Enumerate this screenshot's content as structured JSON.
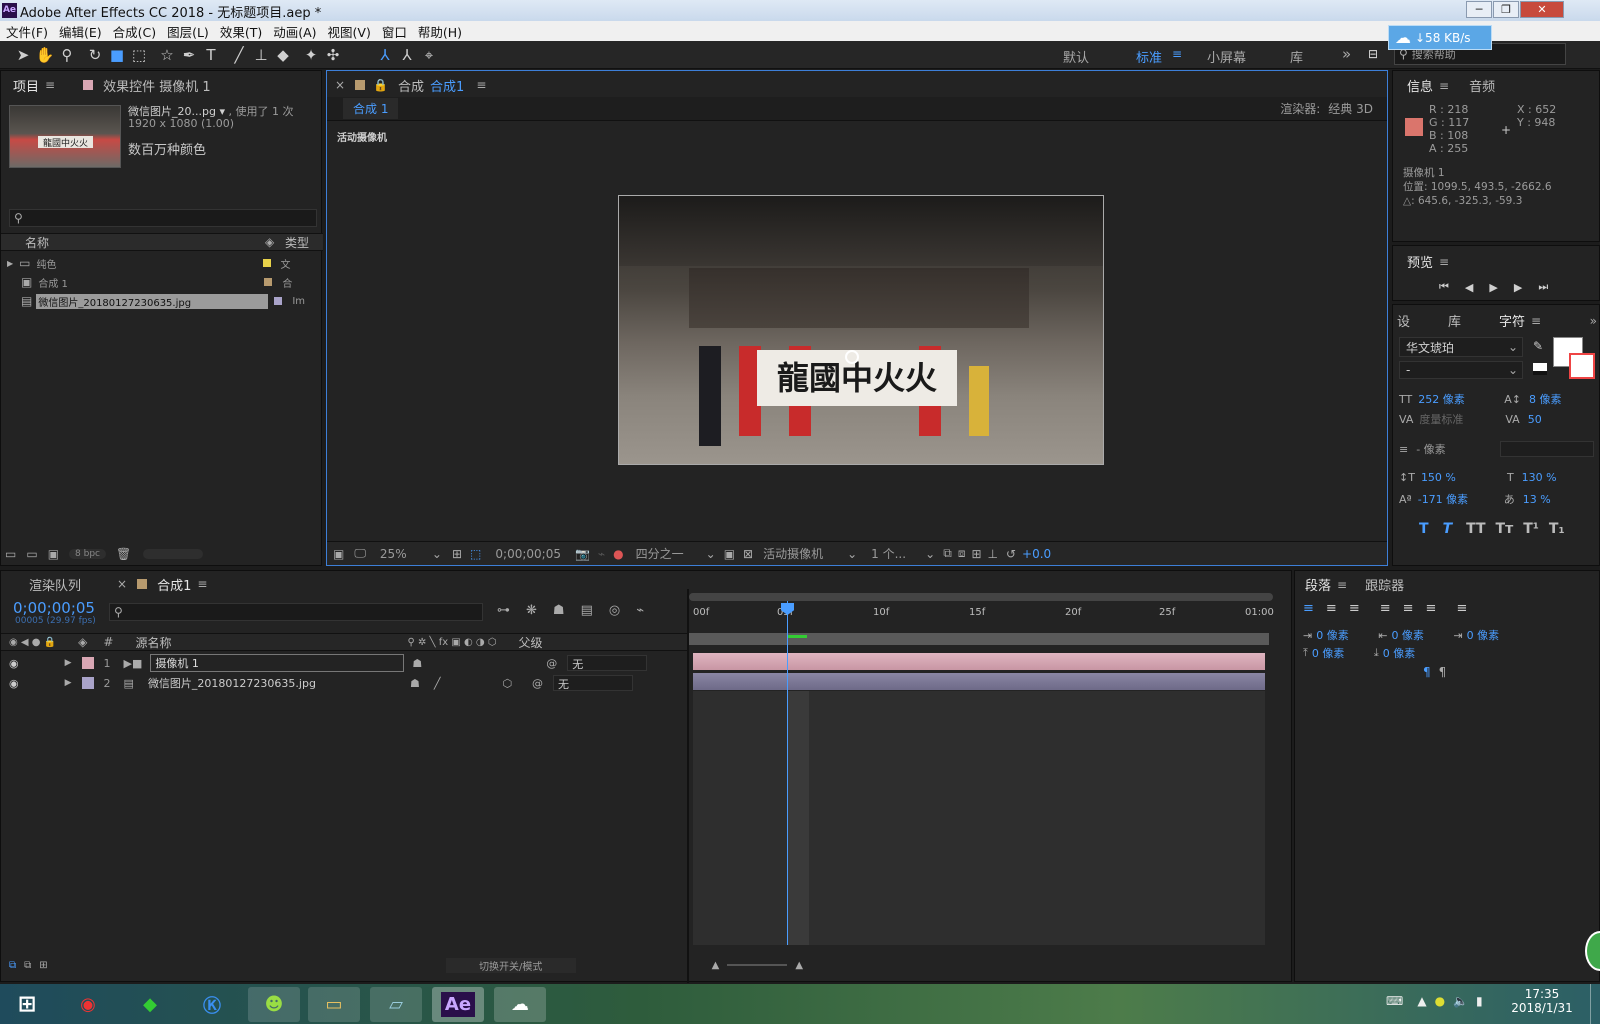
{
  "window": {
    "title": "Adobe After Effects CC 2018 - 无标题项目.aep *",
    "app_icon": "Ae"
  },
  "menu": [
    "文件(F)",
    "编辑(E)",
    "合成(C)",
    "图层(L)",
    "效果(T)",
    "动画(A)",
    "视图(V)",
    "窗口",
    "帮助(H)"
  ],
  "workspaces": {
    "default": "默认",
    "standard": "标准",
    "small_screen": "小屏幕",
    "library": "库",
    "more": "»",
    "search_placeholder": "搜索帮助"
  },
  "net_widget": {
    "speed": "↓58 KB/s"
  },
  "project_panel": {
    "tab_project": "项目",
    "tab_effects": "效果控件 摄像机 1",
    "item_name": "微信图片_20...pg ▾",
    "used": ", 使用了 1 次",
    "dims": "1920 x 1080 (1.00)",
    "colors": "数百万种颜色",
    "col_name": "名称",
    "col_type": "类型",
    "items": [
      {
        "name": "纯色",
        "type": "文",
        "swatch": "#e8d24a"
      },
      {
        "name": "合成 1",
        "type": "合",
        "swatch": "#b79a6e"
      },
      {
        "name": "微信图片_20180127230635.jpg",
        "type": "Im",
        "swatch": "#a9a3c9"
      }
    ],
    "bpc": "8 bpc"
  },
  "comp_panel": {
    "tab_label": "合成",
    "tab_comp": "合成1",
    "comp_chip": "合成 1",
    "renderer_label": "渲染器:",
    "renderer_value": "经典 3D",
    "camera_label": "活动摄像机",
    "banner_text": "龍國中火火",
    "zoom": "25%",
    "timecode": "0;00;00;05",
    "resolution": "四分之一",
    "view": "活动摄像机",
    "views_count": "1 个...",
    "exposure": "+0.0"
  },
  "info_panel": {
    "tab_info": "信息",
    "tab_audio": "音频",
    "r": "R : 218",
    "g": "G : 117",
    "b": "B : 108",
    "a": "A : 255",
    "x": "X : 652",
    "y": "Y : 948",
    "swatch": "#da756c",
    "camera": "摄像机 1",
    "position": "位置: 1099.5, 493.5, -2662.6",
    "delta": "△: 645.6, -325.3, -59.3"
  },
  "preview_panel": {
    "title": "预览"
  },
  "char_panel": {
    "tab_settings": "设",
    "tab_lib": "库",
    "tab_char": "字符",
    "font": "华文琥珀",
    "style": "-",
    "size": "252 像素",
    "leading": "8 像素",
    "kerning": "度量标准",
    "tracking": "50",
    "stroke": "- 像素",
    "vscale": "150 %",
    "hscale": "130 %",
    "baseline": "-171 像素",
    "tsume": "13 %",
    "styles": [
      "T",
      "T",
      "TT",
      "Tт",
      "T¹",
      "T₁"
    ]
  },
  "timeline": {
    "tab_render": "渲染队列",
    "tab_comp": "合成1",
    "timecode": "0;00;00;05",
    "fps": "00005 (29.97 fps)",
    "col_source": "源名称",
    "col_parent": "父级",
    "col_num": "#",
    "ruler": [
      "00f",
      "05f",
      "10f",
      "15f",
      "20f",
      "25f",
      "01:00"
    ],
    "layers": [
      {
        "num": "1",
        "name": "摄像机 1",
        "parent": "无",
        "color": "#d9a7b4"
      },
      {
        "num": "2",
        "name": "微信图片_20180127230635.jpg",
        "parent": "无",
        "color": "#a9a3c9"
      }
    ],
    "toggle_label": "切换开关/模式"
  },
  "paragraph_panel": {
    "tab_para": "段落",
    "tab_tracker": "跟踪器",
    "indent_values": [
      "0 像素",
      "0 像素",
      "0 像素",
      "0 像素",
      "0 像素"
    ]
  },
  "taskbar": {
    "time": "17:35",
    "date": "2018/1/31",
    "ae": "Ae"
  }
}
